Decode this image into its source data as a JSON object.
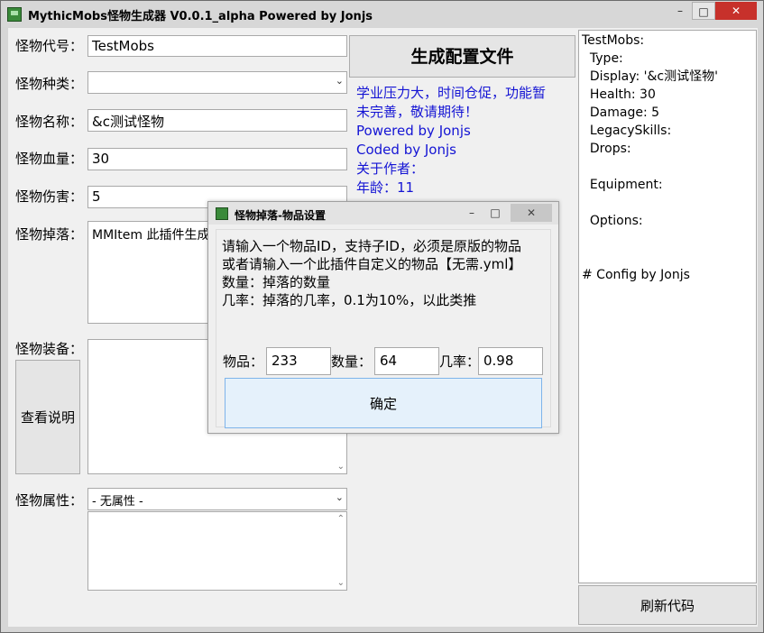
{
  "window": {
    "title": "MythicMobs怪物生成器 V0.0.1_alpha    Powered by Jonjs",
    "controls": {
      "minimize": "–",
      "maximize": "□",
      "close": "✕"
    }
  },
  "form": {
    "code_label": "怪物代号：",
    "code_value": "TestMobs",
    "type_label": "怪物种类：",
    "type_value": "",
    "name_label": "怪物名称：",
    "name_value": "&c测试怪物",
    "health_label": "怪物血量：",
    "health_value": "30",
    "damage_label": "怪物伤害：",
    "damage_value": "5",
    "drops_label": "怪物掉落：",
    "drops_value": "MMItem 此插件生成",
    "equipment_label": "怪物装备：",
    "help_button": "查看说明",
    "attr_label": "怪物属性：",
    "attr_value": "- 无属性 -"
  },
  "generate_button": "生成配置文件",
  "info_lines": [
    "学业压力大，时间仓促，功能暂",
    "未完善，敬请期待！",
    "Powered by Jonjs",
    "Coded by Jonjs",
    "关于作者：",
    "年龄：11"
  ],
  "dialog": {
    "title": "怪物掉落-物品设置",
    "message_lines": [
      "请输入一个物品ID，支持子ID，必须是原版的物品",
      "或者请输入一个此插件自定义的物品【无需.yml】",
      "数量：掉落的数量",
      "几率：掉落的几率，0.1为10%，以此类推"
    ],
    "item_label": "物品：",
    "item_value": "233",
    "amount_label": "数量：",
    "amount_value": "64",
    "chance_label": "几率：",
    "chance_value": "0.98",
    "ok_button": "确定"
  },
  "preview": {
    "text": "TestMobs:\n  Type:\n  Display: '&c测试怪物'\n  Health: 30\n  Damage: 5\n  LegacySkills:\n  Drops:\n\n  Equipment:\n\n  Options:\n\n\n# Config by Jonjs"
  },
  "refresh_button": "刷新代码"
}
